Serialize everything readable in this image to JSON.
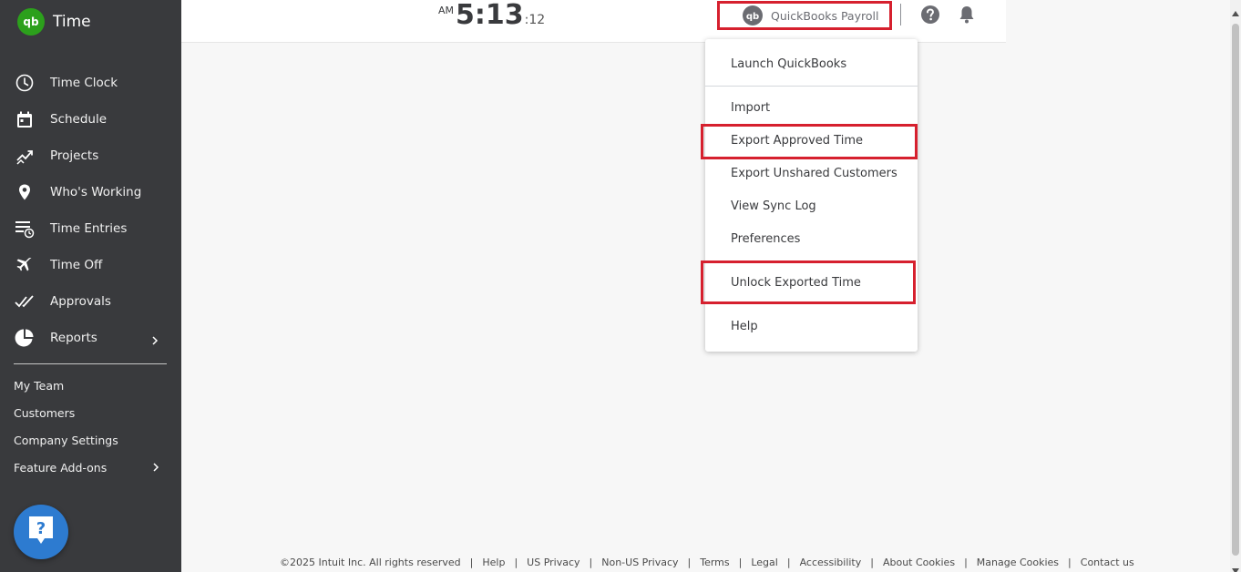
{
  "app": {
    "name": "Time",
    "logo_text": "qb"
  },
  "sidebar": {
    "nav": [
      {
        "label": "Time Clock",
        "icon": "clock-icon"
      },
      {
        "label": "Schedule",
        "icon": "calendar-icon"
      },
      {
        "label": "Projects",
        "icon": "trend-icon"
      },
      {
        "label": "Who's Working",
        "icon": "map-pin-icon"
      },
      {
        "label": "Time Entries",
        "icon": "list-clock-icon"
      },
      {
        "label": "Time Off",
        "icon": "airplane-icon"
      },
      {
        "label": "Approvals",
        "icon": "double-check-icon"
      },
      {
        "label": "Reports",
        "icon": "pie-chart-icon"
      }
    ],
    "sub": [
      {
        "label": "My Team"
      },
      {
        "label": "Customers"
      },
      {
        "label": "Company Settings"
      },
      {
        "label": "Feature Add-ons"
      }
    ],
    "help_fab_glyph": "?"
  },
  "header": {
    "clock": {
      "ampm": "AM",
      "time": "5:13",
      "seconds": ":12"
    },
    "payroll": {
      "logo_text": "qb",
      "label": "QuickBooks Payroll"
    }
  },
  "menu": {
    "items": [
      {
        "label": "Launch QuickBooks"
      },
      {
        "label": "Import"
      },
      {
        "label": "Export Approved Time"
      },
      {
        "label": "Export Unshared Customers"
      },
      {
        "label": "View Sync Log"
      },
      {
        "label": "Preferences"
      },
      {
        "label": "Unlock Exported Time"
      },
      {
        "label": "Help"
      }
    ]
  },
  "footer": {
    "copyright": "©2025 Intuit Inc. All rights reserved",
    "links": [
      "Help",
      "US Privacy",
      "Non-US Privacy",
      "Terms",
      "Legal",
      "Accessibility",
      "About Cookies",
      "Manage Cookies",
      "Contact us"
    ]
  },
  "colors": {
    "sidebar_bg": "#393a3d",
    "brand_green": "#2ca01c",
    "highlight_red": "#d6202e",
    "help_blue": "#2d7bd0"
  }
}
